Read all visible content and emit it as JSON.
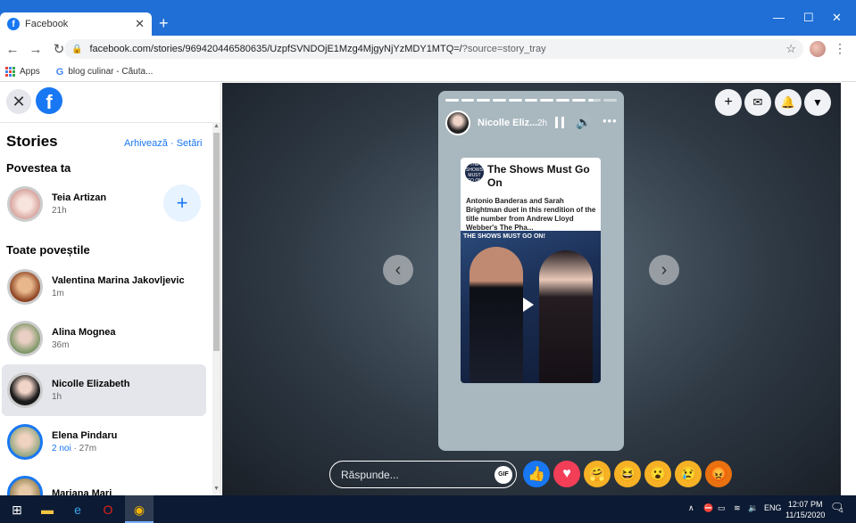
{
  "browser": {
    "tab_title": "Facebook",
    "tab_favicon": "f",
    "url_main": "facebook.com/stories/969420446580635/UzpfSVNDOjE1Mzg4MjgyNjYzMDY1MTQ=/",
    "url_query": "?source=story_tray",
    "bookmarks": [
      "Apps",
      "blog culinar - Căuta..."
    ]
  },
  "sidebar": {
    "title": "Stories",
    "archive_link": "Arhivează",
    "settings_link": "Setări",
    "separator": " · ",
    "your_story_heading": "Povestea ta",
    "your_story": {
      "name": "Teia Artizan",
      "meta": "21h"
    },
    "all_stories_heading": "Toate poveștile",
    "items": [
      {
        "name": "Valentina Marina Jakovljevic",
        "meta": "1m",
        "meta_new": ""
      },
      {
        "name": "Alina Mognea",
        "meta": "36m",
        "meta_new": ""
      },
      {
        "name": "Nicolle Elizabeth",
        "meta": "1h",
        "meta_new": ""
      },
      {
        "name": "Elena Pindaru",
        "meta": " · 27m",
        "meta_new": "2 noi"
      },
      {
        "name": "Mariana Mari",
        "meta": "",
        "meta_new": ""
      }
    ]
  },
  "story": {
    "author": "Nicolle Eliz...",
    "time": "2h",
    "progress_segments": 11,
    "progress_complete": 9,
    "progress_partial_fraction": 0.4,
    "share_title": "The Shows Must Go On",
    "share_description": "Antonio Banderas and Sarah Brightman duet in this rendition of the title number from Andrew Lloyd Webber's The Pha...",
    "image_caption": "THE SHOWS MUST GO ON!",
    "logo_text": "THE SHOWS MUST GO ON"
  },
  "reply": {
    "placeholder": "Răspunde...",
    "gif_label": "GIF"
  },
  "reactions": [
    {
      "name": "like",
      "glyph": "👍",
      "color": "#1877f2"
    },
    {
      "name": "love",
      "glyph": "♥",
      "color": "#f33e58"
    },
    {
      "name": "care",
      "glyph": "🤗",
      "color": "#f7b125"
    },
    {
      "name": "haha",
      "glyph": "😆",
      "color": "#f7b125"
    },
    {
      "name": "wow",
      "glyph": "😮",
      "color": "#f7b125"
    },
    {
      "name": "sad",
      "glyph": "😢",
      "color": "#f7b125"
    },
    {
      "name": "angry",
      "glyph": "😡",
      "color": "#e9710f"
    }
  ],
  "taskbar": {
    "language": "ENG",
    "time": "12:07 PM",
    "date": "11/15/2020",
    "notification_count": "1"
  }
}
